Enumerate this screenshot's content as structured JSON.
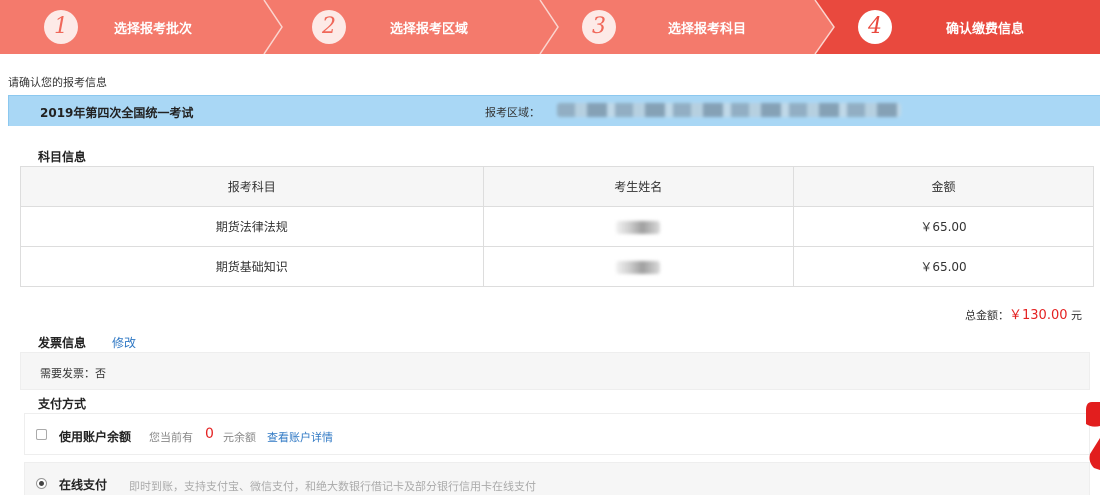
{
  "steps": [
    {
      "num": "1",
      "label": "选择报考批次"
    },
    {
      "num": "2",
      "label": "选择报考区域"
    },
    {
      "num": "3",
      "label": "选择报考科目"
    },
    {
      "num": "4",
      "label": "确认缴费信息"
    }
  ],
  "confirm_tip": "请确认您的报考信息",
  "exam": {
    "title": "2019年第四次全国统一考试",
    "region_label": "报考区域："
  },
  "subjects": {
    "section_title": "科目信息",
    "headers": [
      "报考科目",
      "考生姓名",
      "金额"
    ],
    "rows": [
      {
        "subject": "期货法律法规",
        "amount": "￥65.00"
      },
      {
        "subject": "期货基础知识",
        "amount": "￥65.00"
      }
    ]
  },
  "total": {
    "label": "总金额：",
    "amount": "￥130.00",
    "unit": "元"
  },
  "invoice": {
    "section_title": "发票信息",
    "modify": "修改",
    "need_invoice": "需要发票：否"
  },
  "payment": {
    "section_title": "支付方式",
    "balance": {
      "label": "使用账户余额",
      "prefix": "您当前有",
      "value": "0",
      "suffix": "元余额",
      "link": "查看账户详情"
    },
    "online": {
      "label": "在线支付",
      "desc": "即时到账，支持支付宝、微信支付，和绝大数银行借记卡及部分银行信用卡在线支付"
    }
  },
  "colors": {
    "steps_bg": "#f47a6c",
    "active_step": "#e9493e",
    "header_blue": "#a9d7f5",
    "link": "#2f78c4",
    "price_red": "#e42222"
  }
}
